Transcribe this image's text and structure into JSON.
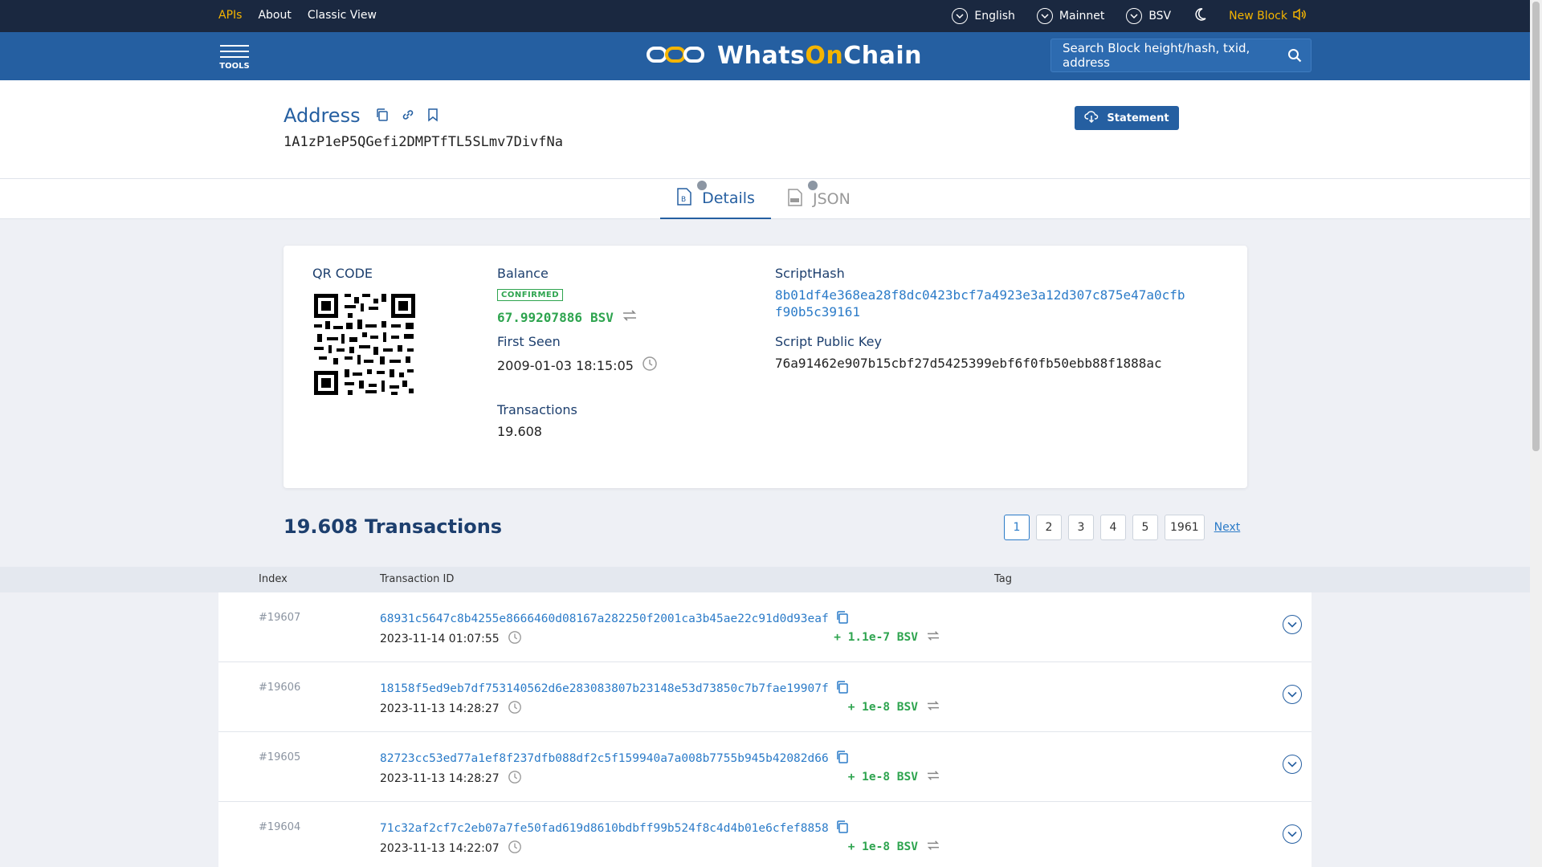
{
  "topnav": {
    "links": [
      "APIs",
      "About",
      "Classic View"
    ],
    "language": "English",
    "network": "Mainnet",
    "chain": "BSV",
    "new_block": "New Block"
  },
  "header": {
    "tools_label": "TOOLS",
    "brand_prefix": "Whats",
    "brand_on": "On",
    "brand_suffix": "Chain",
    "search_placeholder": "Search Block height/hash, txid, address"
  },
  "address": {
    "title": "Address",
    "value": "1A1zP1eP5QGefi2DMPTfTL5SLmv7DivfNa",
    "statement_label": "Statement"
  },
  "tabs": {
    "details": "Details",
    "json": "JSON"
  },
  "details": {
    "qr_label": "QR CODE",
    "balance_label": "Balance",
    "confirmed_label": "CONFIRMED",
    "balance_value": "67.99207886",
    "balance_unit": "BSV",
    "first_seen_label": "First Seen",
    "first_seen_value": "2009-01-03 18:15:05",
    "transactions_label": "Transactions",
    "transactions_value": "19.608",
    "scripthash_label": "ScriptHash",
    "scripthash_line1": "8b01df4e368ea28f8dc0423bcf7a4923e3a12d307c875e47a0cfb",
    "scripthash_line2": "f90b5c39161",
    "script_pubkey_label": "Script Public Key",
    "script_pubkey_value": "76a91462e907b15cbf27d5425399ebf6f0fb50ebb88f1888ac"
  },
  "tx_section": {
    "heading": "19.608 Transactions",
    "pages": [
      "1",
      "2",
      "3",
      "4",
      "5",
      "1961"
    ],
    "next_label": "Next",
    "col_index": "Index",
    "col_txid": "Transaction ID",
    "col_tag": "Tag"
  },
  "transactions": [
    {
      "index": "#19607",
      "txid": "68931c5647c8b4255e8666460d08167a282250f2001ca3b45ae22c91d0d93eaf",
      "time": "2023-11-14 01:07:55",
      "amount": "+ 1.1e-7 BSV"
    },
    {
      "index": "#19606",
      "txid": "18158f5ed9eb7df753140562d6e283083807b23148e53d73850c7b7fae19907f",
      "time": "2023-11-13 14:28:27",
      "amount": "+ 1e-8 BSV"
    },
    {
      "index": "#19605",
      "txid": "82723cc53ed77a1ef8f237dfb088df2c5f159940a7a008b7755b945b42082d66",
      "time": "2023-11-13 14:28:27",
      "amount": "+ 1e-8 BSV"
    },
    {
      "index": "#19604",
      "txid": "71c32af2cf7c2eb07a7fe50fad619d8610bdbff99b524f8c4d4b01e6cfef8858",
      "time": "2023-11-13 14:22:07",
      "amount": "+ 1e-8 BSV"
    }
  ],
  "colors": {
    "nav_bg": "#1a2840",
    "header_bg": "#255fa1",
    "accent_gold": "#f4b400",
    "link_blue": "#2b7bc8",
    "positive_green": "#2ea44f"
  }
}
